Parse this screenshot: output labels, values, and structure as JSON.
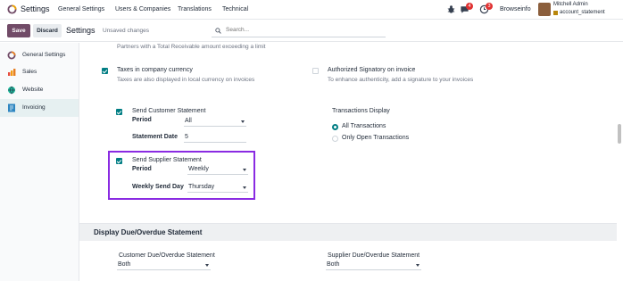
{
  "navbar": {
    "app_title": "Settings",
    "menu": [
      "General Settings",
      "Users & Companies",
      "Translations",
      "Technical"
    ],
    "chat_count": "4",
    "activity_count": "3",
    "company": "Browseinfo",
    "user_name": "Mitchell Admin",
    "db_name": "account_statement"
  },
  "control_panel": {
    "save_label": "Save",
    "discard_label": "Discard",
    "title": "Settings",
    "status": "Unsaved changes",
    "search_placeholder": "Search..."
  },
  "sidebar": {
    "items": [
      {
        "label": "General Settings",
        "icon": "odoo-logo-icon"
      },
      {
        "label": "Sales",
        "icon": "sales-icon"
      },
      {
        "label": "Website",
        "icon": "website-icon"
      },
      {
        "label": "Invoicing",
        "icon": "invoicing-icon",
        "active": true
      }
    ]
  },
  "main": {
    "top_cut_text": "Partners with a Total Receivable amount exceeding a limit",
    "taxes": {
      "title": "Taxes in company currency",
      "desc": "Taxes are also displayed in local currency on invoices",
      "checked": true
    },
    "signatory": {
      "title": "Authorized Signatory on invoice",
      "desc": "To enhance authenticity, add a signature to your invoices",
      "checked": false
    },
    "customer_statement": {
      "title": "Send Customer Statement",
      "checked": true,
      "period_label": "Period",
      "period_value": "All",
      "date_label": "Statement Date",
      "date_value": "5"
    },
    "transactions": {
      "title": "Transactions Display",
      "options": [
        {
          "label": "All Transactions",
          "selected": true
        },
        {
          "label": "Only Open Transactions",
          "selected": false
        }
      ]
    },
    "supplier_statement": {
      "title": "Send Supplier Statement",
      "checked": true,
      "period_label": "Period",
      "period_value": "Weekly",
      "day_label": "Weekly Send Day",
      "day_value": "Thursday"
    },
    "section": {
      "title": "Display Due/Overdue Statement",
      "customer_label": "Customer Due/Overdue Statement",
      "customer_value": "Both",
      "supplier_label": "Supplier Due/Overdue Statement",
      "supplier_value": "Both"
    }
  },
  "colors": {
    "brand": "#714b67",
    "accent": "#017e84",
    "highlight": "#8a2be2",
    "badge": "#e03131"
  }
}
